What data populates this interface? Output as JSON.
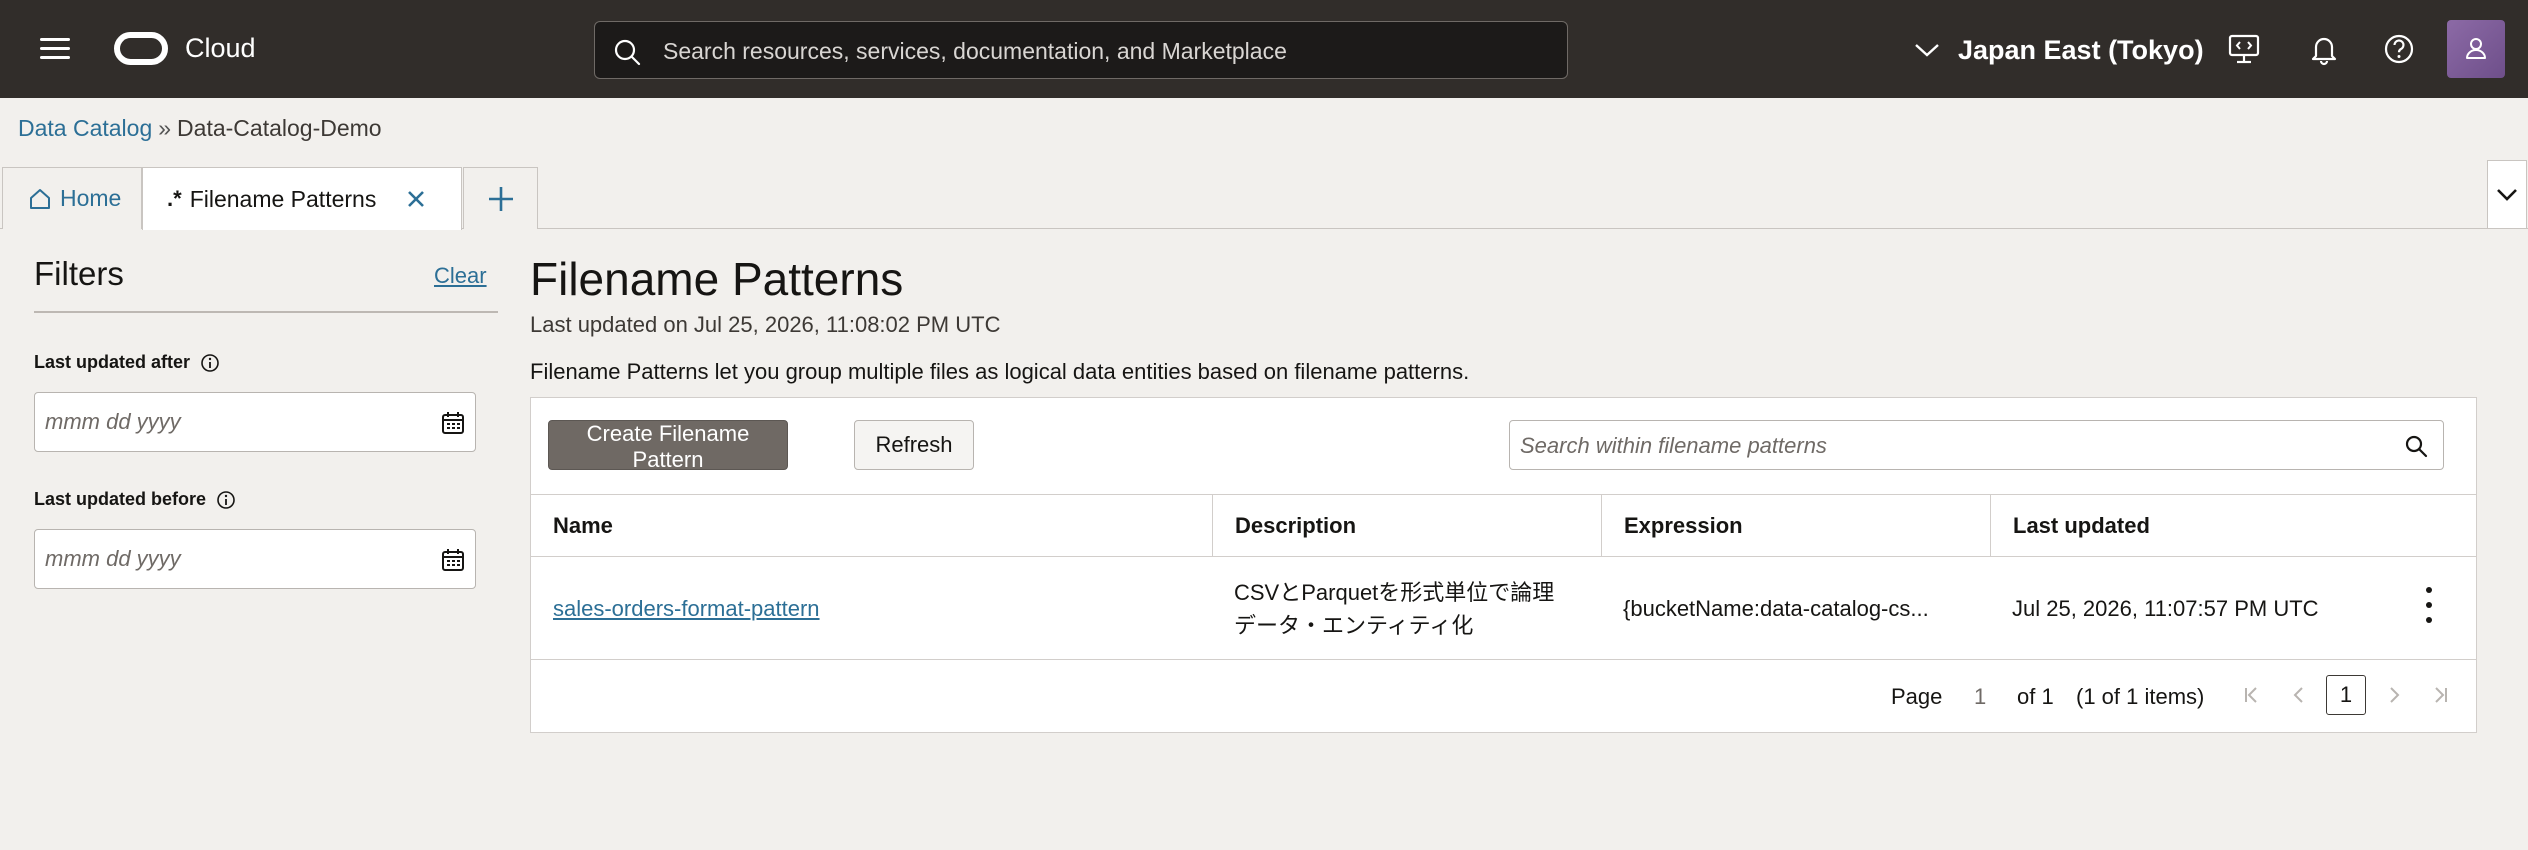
{
  "header": {
    "brand": "Cloud",
    "search_placeholder": "Search resources, services, documentation, and Marketplace",
    "region": "Japan East (Tokyo)"
  },
  "breadcrumb": {
    "root": "Data Catalog",
    "separator": "»",
    "current": "Data-Catalog-Demo"
  },
  "tabs": {
    "home": "Home",
    "active": "Filename Patterns",
    "active_icon_text": ".*"
  },
  "filters": {
    "title": "Filters",
    "clear": "Clear",
    "after_label": "Last updated after",
    "before_label": "Last updated before",
    "date_placeholder": "mmm dd yyyy"
  },
  "main": {
    "title": "Filename Patterns",
    "last_updated": "Last updated on Jul 25, 2026, 11:08:02 PM UTC",
    "description": "Filename Patterns let you group multiple files as logical data entities based on filename patterns.",
    "create_button": "Create Filename Pattern",
    "refresh_button": "Refresh",
    "search_placeholder": "Search within filename patterns"
  },
  "table": {
    "columns": [
      "Name",
      "Description",
      "Expression",
      "Last updated"
    ],
    "rows": [
      {
        "name": "sales-orders-format-pattern",
        "description_line1": "CSVとParquetを形式単位で論理",
        "description_line2": "データ・エンティティ化",
        "expression": "{bucketName:data-catalog-cs...",
        "last_updated": "Jul 25, 2026, 11:07:57 PM UTC"
      }
    ]
  },
  "pager": {
    "page_label": "Page",
    "page_value": "1",
    "of_total": "of 1",
    "items": "(1 of 1 items)",
    "current": "1"
  },
  "colors": {
    "header_bg": "#312d2a",
    "link": "#2c6f96",
    "primary_button": "#6f6964"
  }
}
